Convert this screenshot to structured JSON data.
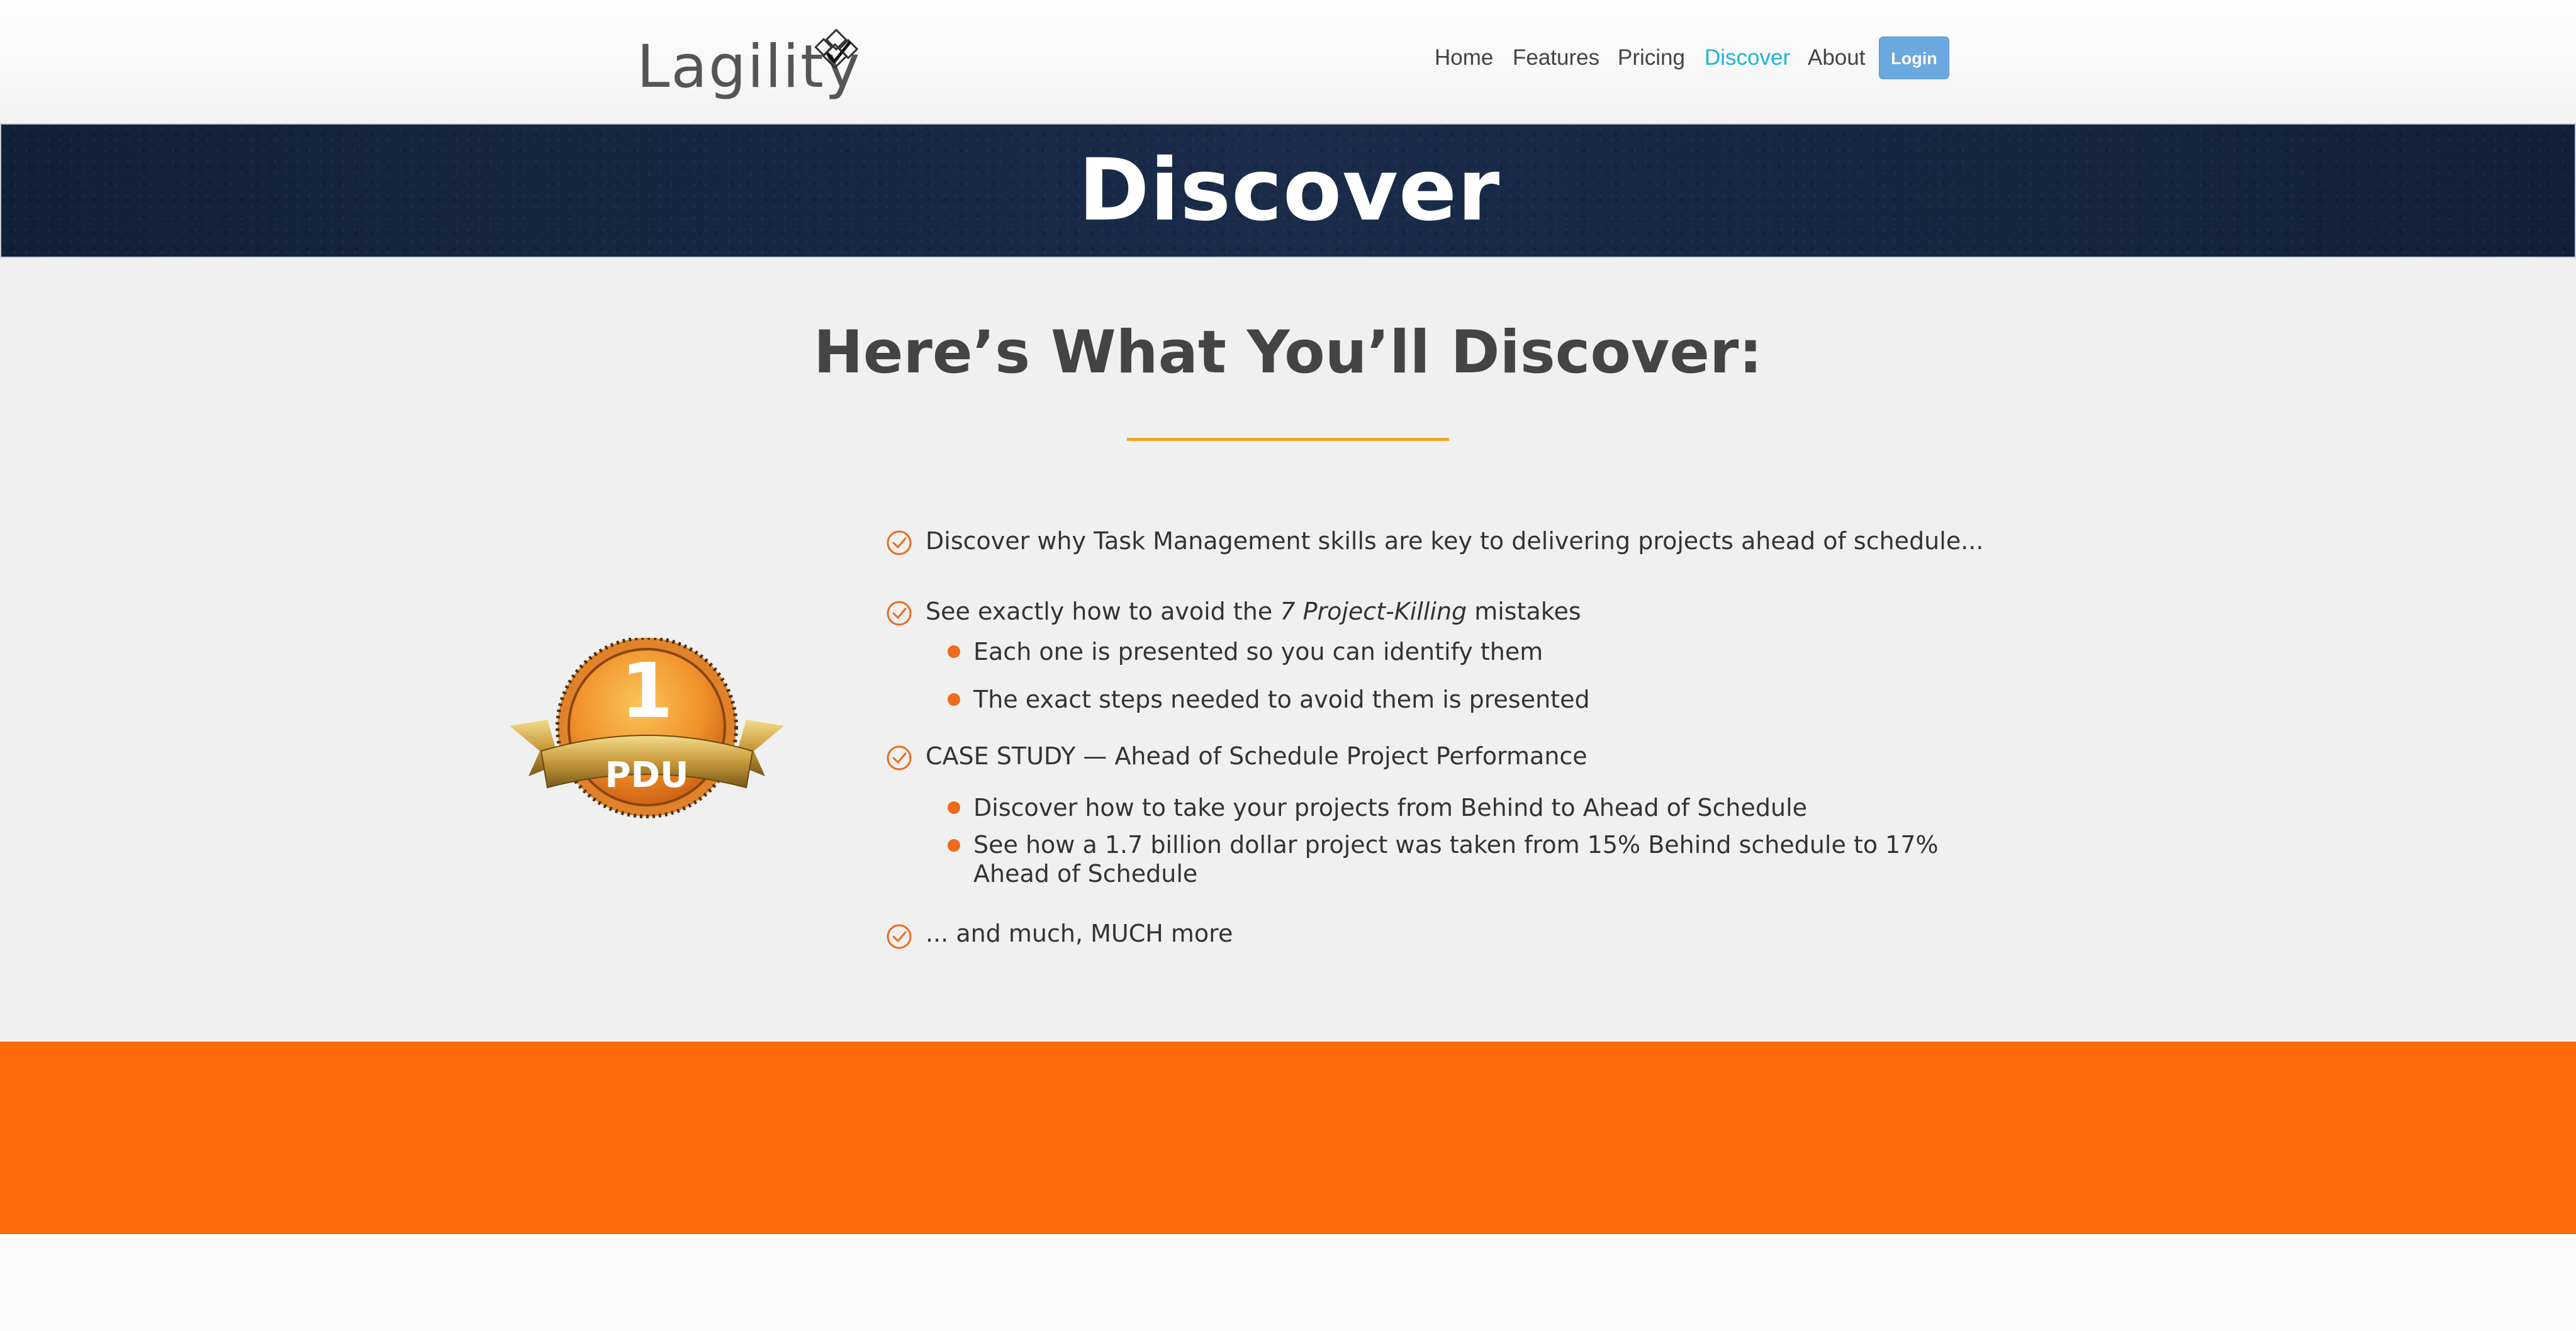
{
  "brand": {
    "logo_text": "Lagility",
    "logo_icon": "checkmark-gear-icon"
  },
  "nav": {
    "items": [
      "Home",
      "Features",
      "Pricing",
      "Discover",
      "About"
    ],
    "active": "Discover",
    "login_label": "Login"
  },
  "banner": {
    "title": "Discover"
  },
  "main": {
    "heading": "Here’s What You’ll Discover:",
    "badge": {
      "number": "1",
      "label": "PDU"
    },
    "items": [
      {
        "text": "Discover why Task Management skills are key to delivering  projects ahead of schedule..."
      },
      {
        "pre": "See exactly how to avoid the ",
        "emphasis": "7 Project-Killing",
        "post": " mistakes",
        "subitems": [
          "Each one is presented so you can identify them",
          "The exact steps needed to avoid them is presented"
        ]
      },
      {
        "text": "CASE STUDY — Ahead of Schedule Project Performance",
        "subitems": [
          "Discover how to take your projects from Behind to Ahead of Schedule",
          "See how a 1.7 billion dollar project was taken from 15% Behind schedule to 17% Ahead of Schedule"
        ]
      },
      {
        "text": "... and much, MUCH more"
      }
    ]
  },
  "colors": {
    "accent_orange": "#fb6a07",
    "underline_gold": "#f5a623",
    "nav_active": "#1ab6d8",
    "login_button": "#6aa8df",
    "banner_navy": "#142440"
  }
}
